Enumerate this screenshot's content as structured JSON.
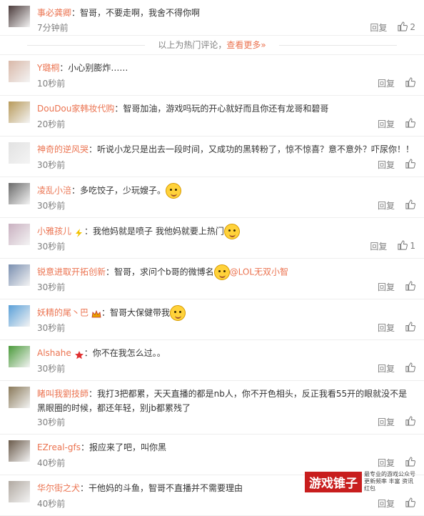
{
  "hot_comments": [
    {
      "username": "事必龚卿",
      "text": "智哥，不要走啊，我舍不得你啊",
      "time": "7分钟前",
      "reply_label": "回复",
      "likes": "2",
      "avatar_color": "#4a3a3a"
    }
  ],
  "divider": {
    "text": "以上为热门评论，",
    "link": "查看更多»"
  },
  "comments": [
    {
      "username": "Y璐桐",
      "text": "小心别膨炸……",
      "time": "10秒前",
      "avatar_color": "#d9b8a8"
    },
    {
      "username": "DouDou家韩妆代购",
      "text": "智哥加油，游戏吗玩的开心就好而且你还有龙哥和碧哥",
      "time": "20秒前",
      "avatar_color": "#b89a5a"
    },
    {
      "username": "神奇的逆风哭",
      "text": "听说小龙只是出去一段时间，又成功的黑转粉了，惊不惊喜？意不意外？吓尿你！！",
      "time": "30秒前",
      "avatar_color": "#e2e2e2"
    },
    {
      "username": "凌乱小涪",
      "text": "多吃饺子，少玩嫂子。",
      "time": "30秒前",
      "avatar_color": "#6a6a6a",
      "emoji": "thinking-emoji"
    },
    {
      "username": "小雅孩儿",
      "text": "我他妈就是喷子 我他妈就要上热门",
      "time": "30秒前",
      "likes": "1",
      "avatar_color": "#c9b0c0",
      "emoji": "sleepy-emoji",
      "badge": "lightning-badge"
    },
    {
      "username": "锐意进取开拓创新",
      "text": "智哥，求问个b哥的微博名",
      "mention": "@LOL无双小智",
      "time": "30秒前",
      "avatar_color": "#7a8fb0",
      "emoji": "grin-emoji"
    },
    {
      "username": "妖精的尾丶巴",
      "text": "智哥大保健带我",
      "time": "30秒前",
      "avatar_color": "#5aa0d8",
      "emoji": "cry-emoji",
      "badge": "crown-badge"
    },
    {
      "username": "Alshahe",
      "text": "你不在我怎么过。。",
      "time": "30秒前",
      "avatar_color": "#4a9a3a",
      "badge": "star-badge"
    },
    {
      "username": "睹叫我劉技師",
      "text": "我打3把都累，天天直播的都是nb人，你不开色相头，反正我看55开的眼就没不是黑眼圈的时候，都还年轻，别jb都累残了",
      "time": "30秒前",
      "avatar_color": "#8a7a5a"
    },
    {
      "username": "EZreal-gfs",
      "text": "报应来了吧，叫你黑",
      "time": "40秒前",
      "avatar_color": "#6a5a4a"
    },
    {
      "username": "华尔街之犬",
      "text": "干他妈的斗鱼，智哥不直播并不需要理由",
      "time": "40秒前",
      "avatar_color": "#b0a8a0"
    }
  ],
  "labels": {
    "reply": "回复",
    "separator": "："
  },
  "watermark": {
    "title": "游戏锥子",
    "subtitle": "最专业的游戏公众号 更新频率 丰富 资讯 红包"
  },
  "colors": {
    "username": "#eb7350",
    "text": "#333333",
    "meta": "#808080"
  }
}
